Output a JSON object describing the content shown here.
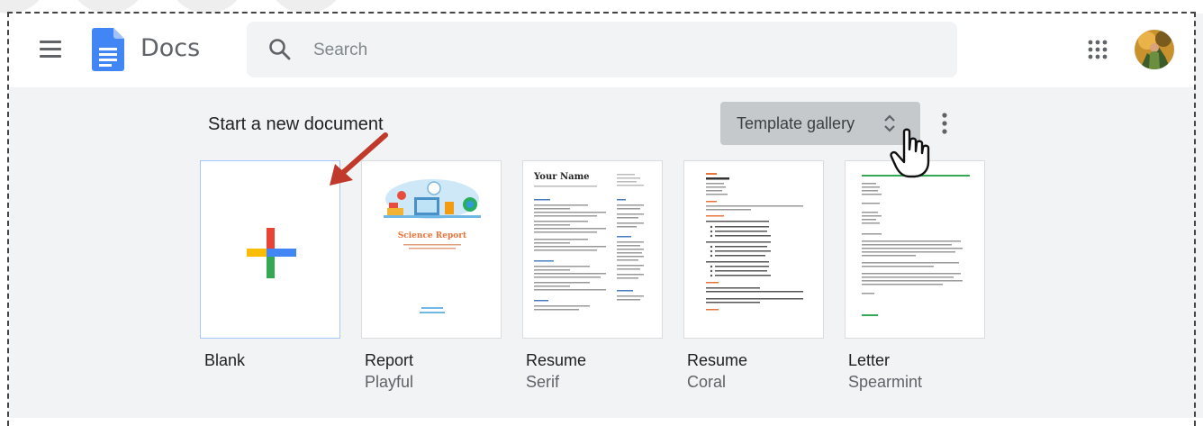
{
  "app": {
    "title": "Docs",
    "menu_icon": "hamburger-menu-icon",
    "logo_icon": "google-docs-icon"
  },
  "search": {
    "placeholder": "Search",
    "icon": "search-icon"
  },
  "header_right": {
    "apps_icon": "apps-grid-icon",
    "avatar": "account-avatar"
  },
  "templates": {
    "section_title": "Start a new document",
    "gallery_button": "Template gallery",
    "gallery_icon": "unfold-icon",
    "more_icon": "more-vert-icon",
    "items": [
      {
        "title": "Blank",
        "subtitle": ""
      },
      {
        "title": "Report",
        "subtitle": "Playful"
      },
      {
        "title": "Resume",
        "subtitle": "Serif"
      },
      {
        "title": "Resume",
        "subtitle": "Coral"
      },
      {
        "title": "Letter",
        "subtitle": "Spearmint"
      }
    ],
    "report_thumb": {
      "heading": "Science Report"
    },
    "resume_serif_thumb": {
      "name": "Your Name"
    }
  },
  "colors": {
    "accent_blue": "#4285f4",
    "plus_red": "#ea4335",
    "plus_yellow": "#fbbc04",
    "plus_green": "#34a853",
    "annotation_arrow": "#c0392b",
    "page_bg": "#f1f3f4"
  }
}
